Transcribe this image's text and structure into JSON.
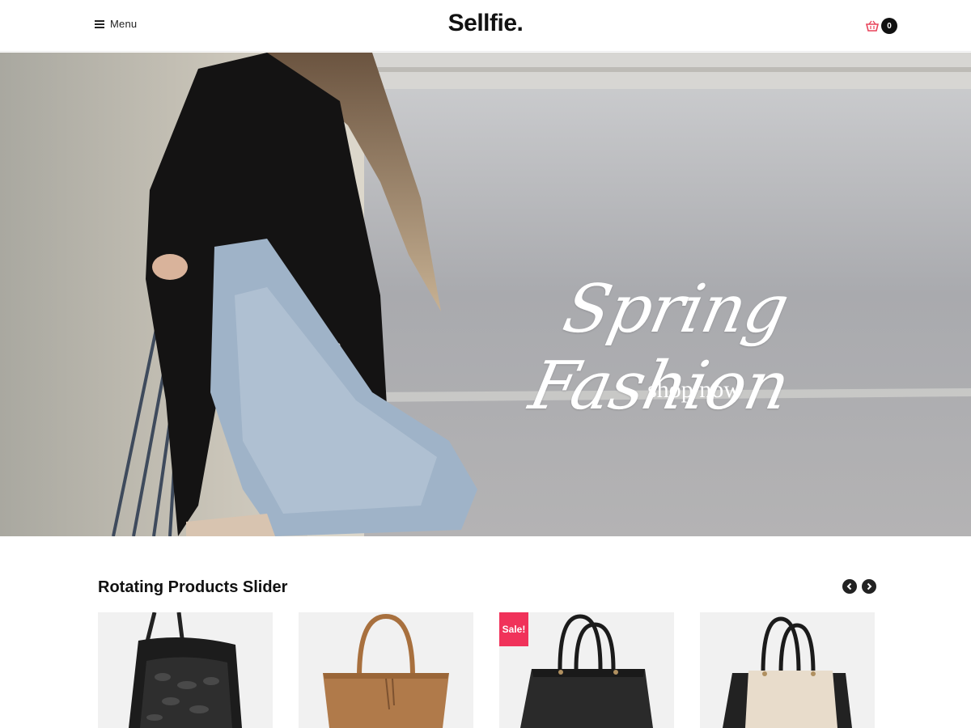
{
  "header": {
    "menu_label": "Menu",
    "menu_icon": "hamburger-icon",
    "logo": "Sellfie.",
    "cart_icon": "shopping-basket-icon",
    "cart_count": "0"
  },
  "hero": {
    "title": "Spring Fashion",
    "cta": "shop now"
  },
  "products_section": {
    "title": "Rotating Products Slider",
    "prev_icon": "chevron-left-icon",
    "next_icon": "chevron-right-icon",
    "products": [
      {
        "image": "black-leather-backpack",
        "badge": ""
      },
      {
        "image": "tan-tote-bag",
        "badge": ""
      },
      {
        "image": "black-handbag",
        "badge": "Sale!"
      },
      {
        "image": "beige-black-handbag",
        "badge": ""
      }
    ]
  },
  "colors": {
    "accent_sale": "#f0325a",
    "cart_icon": "#e8435a",
    "text_dark": "#111111"
  }
}
